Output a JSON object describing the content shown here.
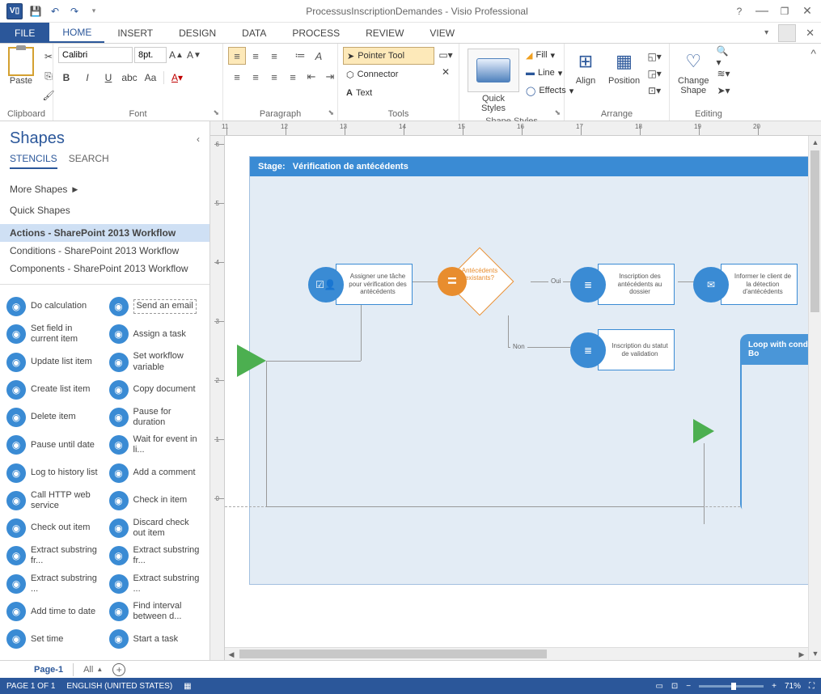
{
  "titlebar": {
    "document_title": "ProcessusInscriptionDemandes - Visio Professional"
  },
  "ribbon": {
    "tabs": [
      "FILE",
      "HOME",
      "INSERT",
      "DESIGN",
      "DATA",
      "PROCESS",
      "REVIEW",
      "VIEW"
    ],
    "active_tab": "HOME",
    "clipboard": {
      "paste": "Paste",
      "label": "Clipboard"
    },
    "font": {
      "name": "Calibri",
      "size": "8pt.",
      "label": "Font"
    },
    "paragraph": {
      "label": "Paragraph"
    },
    "tools": {
      "pointer": "Pointer Tool",
      "connector": "Connector",
      "text": "Text",
      "label": "Tools"
    },
    "shape_styles": {
      "quick_styles": "Quick\nStyles",
      "fill": "Fill",
      "line": "Line",
      "effects": "Effects",
      "label": "Shape Styles"
    },
    "arrange": {
      "align": "Align",
      "position": "Position",
      "label": "Arrange"
    },
    "editing": {
      "change_shape": "Change\nShape",
      "label": "Editing"
    }
  },
  "shapes_panel": {
    "title": "Shapes",
    "tab_stencils": "STENCILS",
    "tab_search": "SEARCH",
    "more_shapes": "More Shapes",
    "quick_shapes": "Quick Shapes",
    "stencils": [
      "Actions - SharePoint 2013 Workflow",
      "Conditions - SharePoint 2013 Workflow",
      "Components - SharePoint 2013 Workflow"
    ],
    "active_stencil": 0,
    "shapes_col1": [
      "Do calculation",
      "Set field in current item",
      "Update list item",
      "Create list item",
      "Delete item",
      "Pause until date",
      "Log to history list",
      "Call HTTP web service",
      "Check out item",
      "Extract substring fr...",
      "Extract substring ...",
      "Add time to date",
      "Set time"
    ],
    "shapes_col2": [
      "Send an email",
      "Assign a task",
      "Set workflow variable",
      "Copy document",
      "Pause for duration",
      "Wait for event in li...",
      "Add a comment",
      "Check in item",
      "Discard check out item",
      "Extract substring fr...",
      "Extract substring ...",
      "Find interval between d...",
      "Start a task"
    ],
    "selected_shape": "Send an email"
  },
  "diagram": {
    "stage_prefix": "Stage:",
    "stage_name": "Vérification de antécédents",
    "task1": "Assigner une tâche pour vérification des antécédents",
    "decision": "Antécédents existants?",
    "yes": "Oui",
    "no": "Non",
    "task2": "Inscription des antécédents au dossier",
    "task3": "Inscription du statut de validation",
    "task4": "Informer le client de la détection d'antécédents",
    "loop_title": "Loop with condition:   Bo"
  },
  "ruler_h": [
    "11",
    "12",
    "13",
    "14",
    "15",
    "16",
    "17",
    "18",
    "19",
    "20"
  ],
  "ruler_v": [
    "6",
    "5",
    "4",
    "3",
    "2",
    "1",
    "0"
  ],
  "page_tabs": {
    "page1": "Page-1",
    "all": "All"
  },
  "statusbar": {
    "page": "PAGE 1 OF 1",
    "lang": "ENGLISH (UNITED STATES)",
    "zoom": "71%"
  }
}
